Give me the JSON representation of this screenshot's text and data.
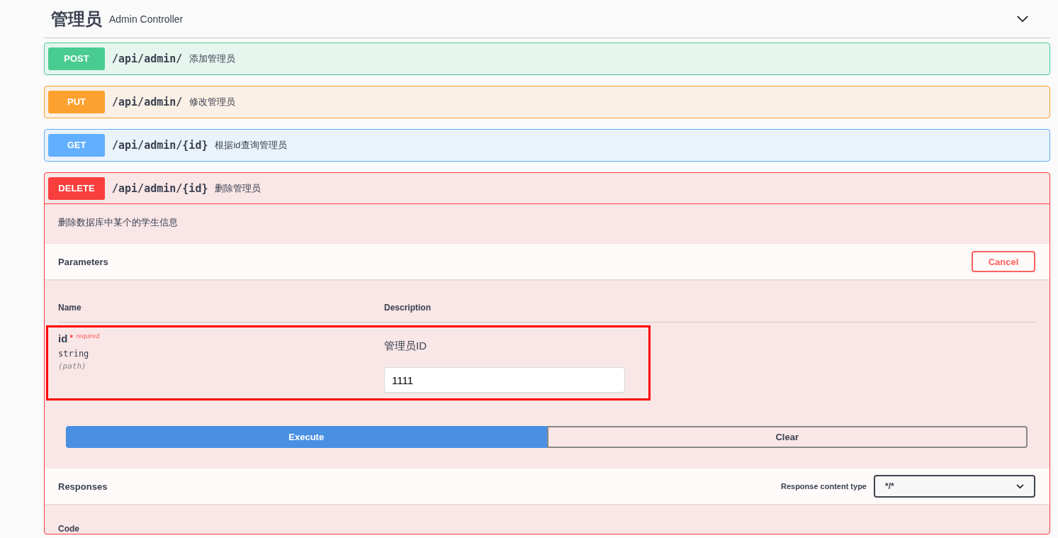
{
  "section": {
    "title": "管理员",
    "subtitle": "Admin Controller",
    "expanded": true
  },
  "operations": [
    {
      "method": "POST",
      "path": "/api/admin/",
      "summary": "添加管理员",
      "color": "#49cc90",
      "expanded": false
    },
    {
      "method": "PUT",
      "path": "/api/admin/",
      "summary": "修改管理员",
      "color": "#fca130",
      "expanded": false
    },
    {
      "method": "GET",
      "path": "/api/admin/{id}",
      "summary": "根据id查询管理员",
      "color": "#61affe",
      "expanded": false
    },
    {
      "method": "DELETE",
      "path": "/api/admin/{id}",
      "summary": "删除管理员",
      "color": "#f93e3e",
      "expanded": true
    }
  ],
  "detail": {
    "description": "删除数据库中某个的学生信息",
    "parameters_title": "Parameters",
    "cancel": "Cancel",
    "columns": [
      "Name",
      "Description"
    ],
    "params": [
      {
        "name": "id",
        "required_mark": "*",
        "required": "required",
        "type": "string",
        "location": "(path)",
        "description": "管理员ID",
        "value": "1111",
        "highlighted": true
      }
    ],
    "execute": "Execute",
    "clear": "Clear",
    "responses_title": "Responses",
    "content_type_label": "Response content type",
    "content_type": "*/*",
    "code_heading": "Code"
  }
}
